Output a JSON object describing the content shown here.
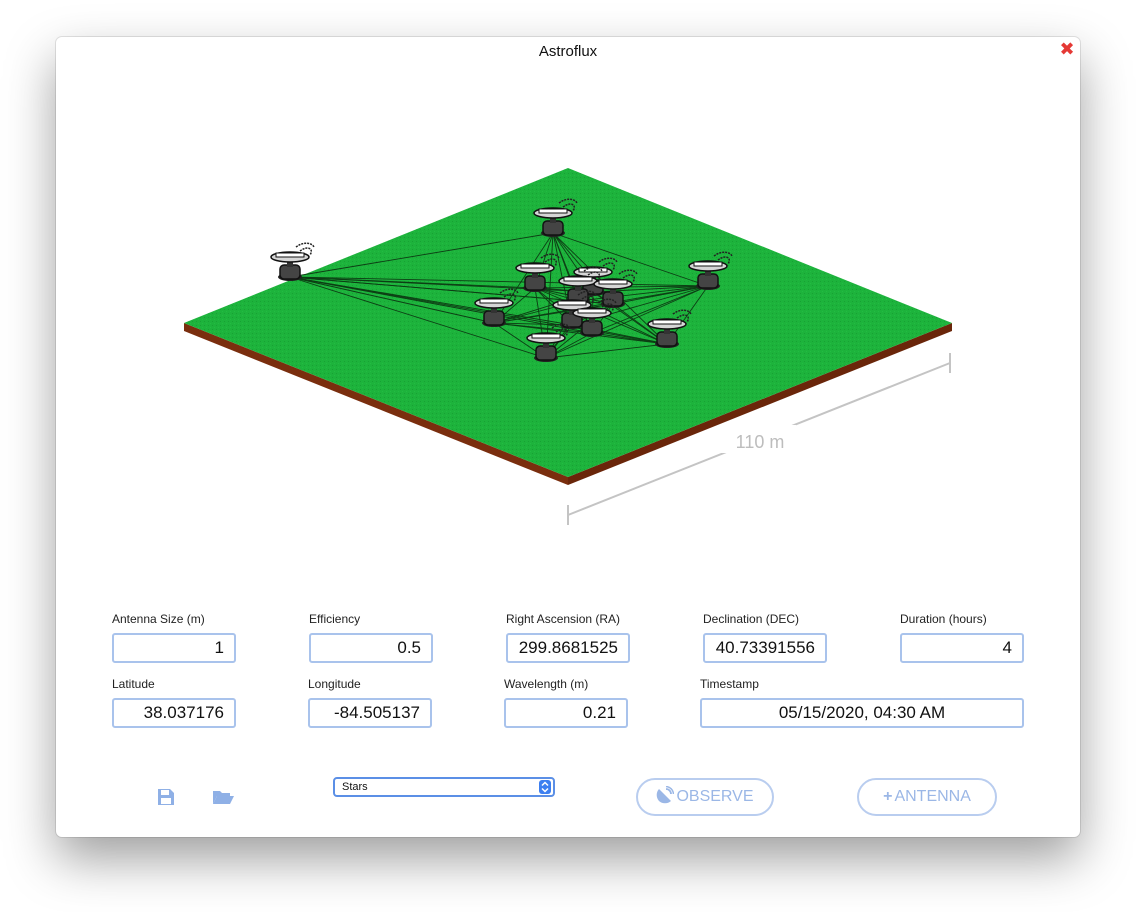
{
  "window": {
    "title": "Astroflux",
    "close_glyph": "✖"
  },
  "scene": {
    "scale_label": "110 m",
    "ground_color": "#1db33c",
    "soil_color": "#7a2e0e"
  },
  "fields": {
    "antenna_size": {
      "label": "Antenna Size (m)",
      "value": "1"
    },
    "efficiency": {
      "label": "Efficiency",
      "value": "0.5"
    },
    "ra": {
      "label": "Right Ascension (RA)",
      "value": "299.8681525"
    },
    "dec": {
      "label": "Declination (DEC)",
      "value": "40.73391556"
    },
    "duration": {
      "label": "Duration (hours)",
      "value": "4"
    },
    "latitude": {
      "label": "Latitude",
      "value": "38.037176"
    },
    "longitude": {
      "label": "Longitude",
      "value": "-84.505137"
    },
    "wavelength": {
      "label": "Wavelength (m)",
      "value": "0.21"
    },
    "timestamp": {
      "label": "Timestamp",
      "value": "05/15/2020, 04:30 AM"
    }
  },
  "toolbar": {
    "save_icon": "save-icon",
    "open_icon": "folder-open-icon",
    "source_select": "Stars",
    "observe_label": "OBSERVE",
    "add_antenna_label": "ANTENNA",
    "accent_color": "#9bb7e6"
  }
}
